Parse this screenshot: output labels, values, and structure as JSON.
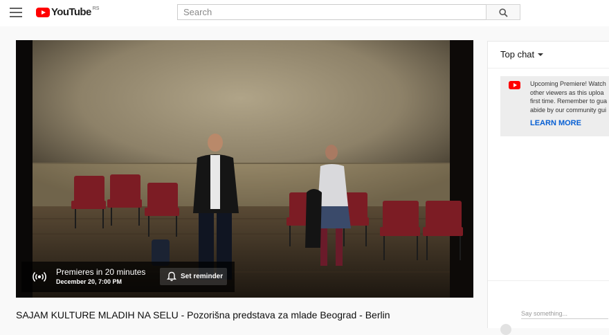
{
  "header": {
    "logo_text": "YouTube",
    "country_code": "RS",
    "search_placeholder": "Search"
  },
  "player": {
    "premiere_title": "Premieres in 20 minutes",
    "premiere_date": "December 20, 7:00 PM",
    "reminder_label": "Set reminder"
  },
  "video": {
    "title": "SAJAM KULTURE MLADIH NA SELU - Pozorišna predstava za mlade Beograd - Berlin"
  },
  "chat": {
    "header_label": "Top chat",
    "notice_lines": [
      "Upcoming Premiere! Watch",
      "other viewers as this uploa",
      "first time. Remember to gua",
      "abide by our community gui"
    ],
    "learn_more": "LEARN MORE",
    "input_placeholder": "Say something..."
  },
  "colors": {
    "brand_red": "#ff0000",
    "link_blue": "#065fd4"
  },
  "icons": [
    "menu-icon",
    "youtube-logo-icon",
    "search-icon",
    "broadcast-icon",
    "bell-icon",
    "caret-down-icon"
  ]
}
